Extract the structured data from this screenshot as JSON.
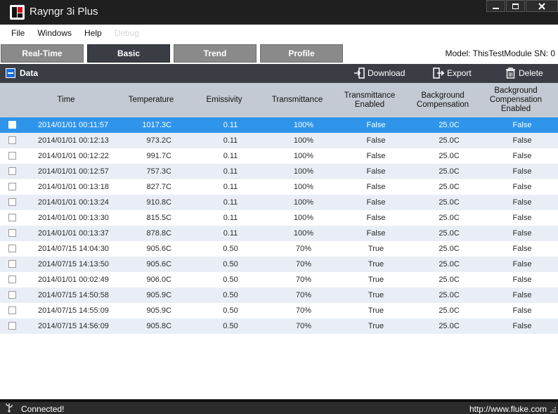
{
  "window": {
    "title": "Rayngr 3i Plus"
  },
  "menu": {
    "items": [
      "File",
      "Windows",
      "Help",
      "Debug"
    ]
  },
  "tabs": [
    {
      "label": "Real-Time",
      "active": false
    },
    {
      "label": "Basic",
      "active": true
    },
    {
      "label": "Trend",
      "active": false
    },
    {
      "label": "Profile",
      "active": false
    }
  ],
  "model_info": "Model: ThisTestModule SN: 0",
  "data_panel": {
    "title": "Data",
    "download_label": "Download",
    "export_label": "Export",
    "delete_label": "Delete"
  },
  "table": {
    "headers": [
      "Time",
      "Temperature",
      "Emissivity",
      "Transmittance",
      "Transmittance Enabled",
      "Background Compensation",
      "Background Compensation Enabled"
    ],
    "selected_row": 0,
    "rows": [
      [
        "2014/01/01 00:11:57",
        "1017.3C",
        "0.11",
        "100%",
        "False",
        "25.0C",
        "False"
      ],
      [
        "2014/01/01 00:12:13",
        "973.2C",
        "0.11",
        "100%",
        "False",
        "25.0C",
        "False"
      ],
      [
        "2014/01/01 00:12:22",
        "991.7C",
        "0.11",
        "100%",
        "False",
        "25.0C",
        "False"
      ],
      [
        "2014/01/01 00:12:57",
        "757.3C",
        "0.11",
        "100%",
        "False",
        "25.0C",
        "False"
      ],
      [
        "2014/01/01 00:13:18",
        "827.7C",
        "0.11",
        "100%",
        "False",
        "25.0C",
        "False"
      ],
      [
        "2014/01/01 00:13:24",
        "910.8C",
        "0.11",
        "100%",
        "False",
        "25.0C",
        "False"
      ],
      [
        "2014/01/01 00:13:30",
        "815.5C",
        "0.11",
        "100%",
        "False",
        "25.0C",
        "False"
      ],
      [
        "2014/01/01 00:13:37",
        "878.8C",
        "0.11",
        "100%",
        "False",
        "25.0C",
        "False"
      ],
      [
        "2014/07/15 14:04:30",
        "905.6C",
        "0.50",
        "70%",
        "True",
        "25.0C",
        "False"
      ],
      [
        "2014/07/15 14:13:50",
        "905.6C",
        "0.50",
        "70%",
        "True",
        "25.0C",
        "False"
      ],
      [
        "2014/01/01 00:02:49",
        "906.0C",
        "0.50",
        "70%",
        "True",
        "25.0C",
        "False"
      ],
      [
        "2014/07/15 14:50:58",
        "905.9C",
        "0.50",
        "70%",
        "True",
        "25.0C",
        "False"
      ],
      [
        "2014/07/15 14:55:09",
        "905.9C",
        "0.50",
        "70%",
        "True",
        "25.0C",
        "False"
      ],
      [
        "2014/07/15 14:56:09",
        "905.8C",
        "0.50",
        "70%",
        "True",
        "25.0C",
        "False"
      ]
    ]
  },
  "status": {
    "text": "Connected!",
    "link": "http://www.fluke.com"
  },
  "icons": [
    "app-logo-icon",
    "minimize-icon",
    "maximize-icon",
    "close-icon",
    "collapse-icon",
    "download-icon",
    "export-icon",
    "delete-icon",
    "usb-icon",
    "resize-grip-icon"
  ],
  "colors": {
    "titlebar": "#1f1f1f",
    "active_tab": "#3a3d44",
    "inactive_tab": "#8a8a8a",
    "selected_row": "#2f95ea",
    "alt_row": "#e9eef6",
    "header_row": "#c4cad3"
  }
}
